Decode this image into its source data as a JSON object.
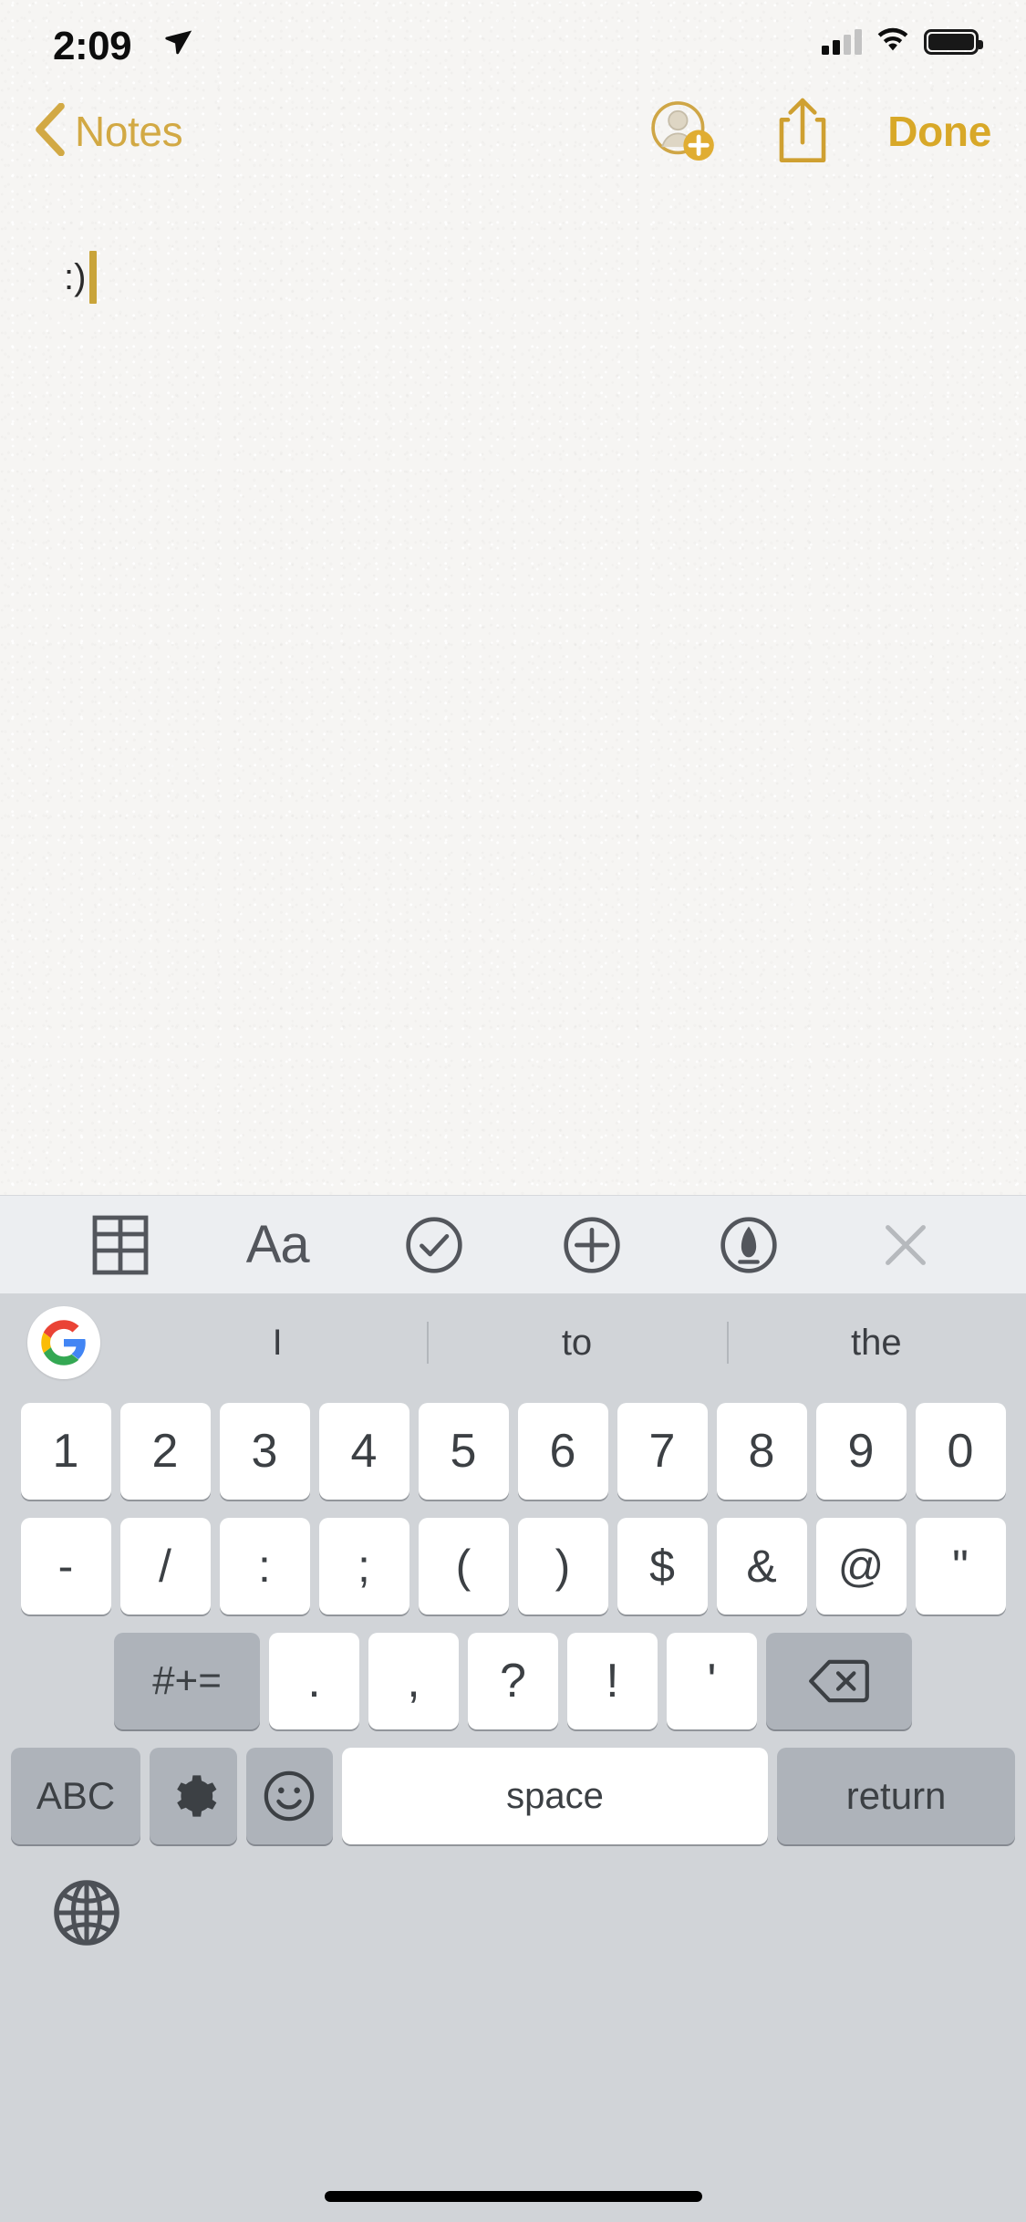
{
  "status_bar": {
    "time": "2:09",
    "location_icon": "location-arrow-icon",
    "signal_icon": "cellular-signal-icon",
    "signal_bars_filled": 2,
    "signal_bars_total": 4,
    "wifi_icon": "wifi-icon",
    "battery_icon": "battery-full-icon",
    "battery_level_percent": 100
  },
  "nav_bar": {
    "back_label": "Notes",
    "back_chevron_icon": "chevron-left-icon",
    "add_person_icon": "add-person-icon",
    "share_icon": "share-upload-icon",
    "done_label": "Done",
    "accent_color": "#d2a944"
  },
  "note": {
    "text": ":)",
    "caret_color": "#c9a43a",
    "paper_color": "#f6f5f3"
  },
  "format_toolbar": {
    "background": "#eceef1",
    "items": [
      {
        "name": "table-icon",
        "label": ""
      },
      {
        "name": "text-format-icon",
        "label": "Aa"
      },
      {
        "name": "checklist-icon",
        "label": ""
      },
      {
        "name": "add-attachment-icon",
        "label": ""
      },
      {
        "name": "markup-pen-icon",
        "label": ""
      },
      {
        "name": "close-icon",
        "label": ""
      }
    ]
  },
  "keyboard": {
    "type": "gboard-symbols",
    "background": "#d1d4d8",
    "key_color": "#ffffff",
    "modifier_key_color": "#aeb3ba",
    "suggestions": {
      "logo_icon": "google-g-icon",
      "items": [
        "I",
        "to",
        "the"
      ]
    },
    "rows": {
      "numbers": [
        "1",
        "2",
        "3",
        "4",
        "5",
        "6",
        "7",
        "8",
        "9",
        "0"
      ],
      "punctuation": [
        "-",
        "/",
        ":",
        ";",
        "(",
        ")",
        "$",
        "&",
        "@",
        "\""
      ],
      "marks": {
        "symbol_shift": "#+=",
        "keys": [
          ".",
          ",",
          "?",
          "!",
          "'"
        ],
        "backspace_icon": "backspace-icon"
      },
      "bottom": {
        "abc": "ABC",
        "settings_icon": "gear-icon",
        "emoji_icon": "emoji-smiley-icon",
        "space": "space",
        "return": "return"
      }
    },
    "globe_icon": "globe-language-icon"
  },
  "home_indicator": {
    "color": "#000000"
  }
}
